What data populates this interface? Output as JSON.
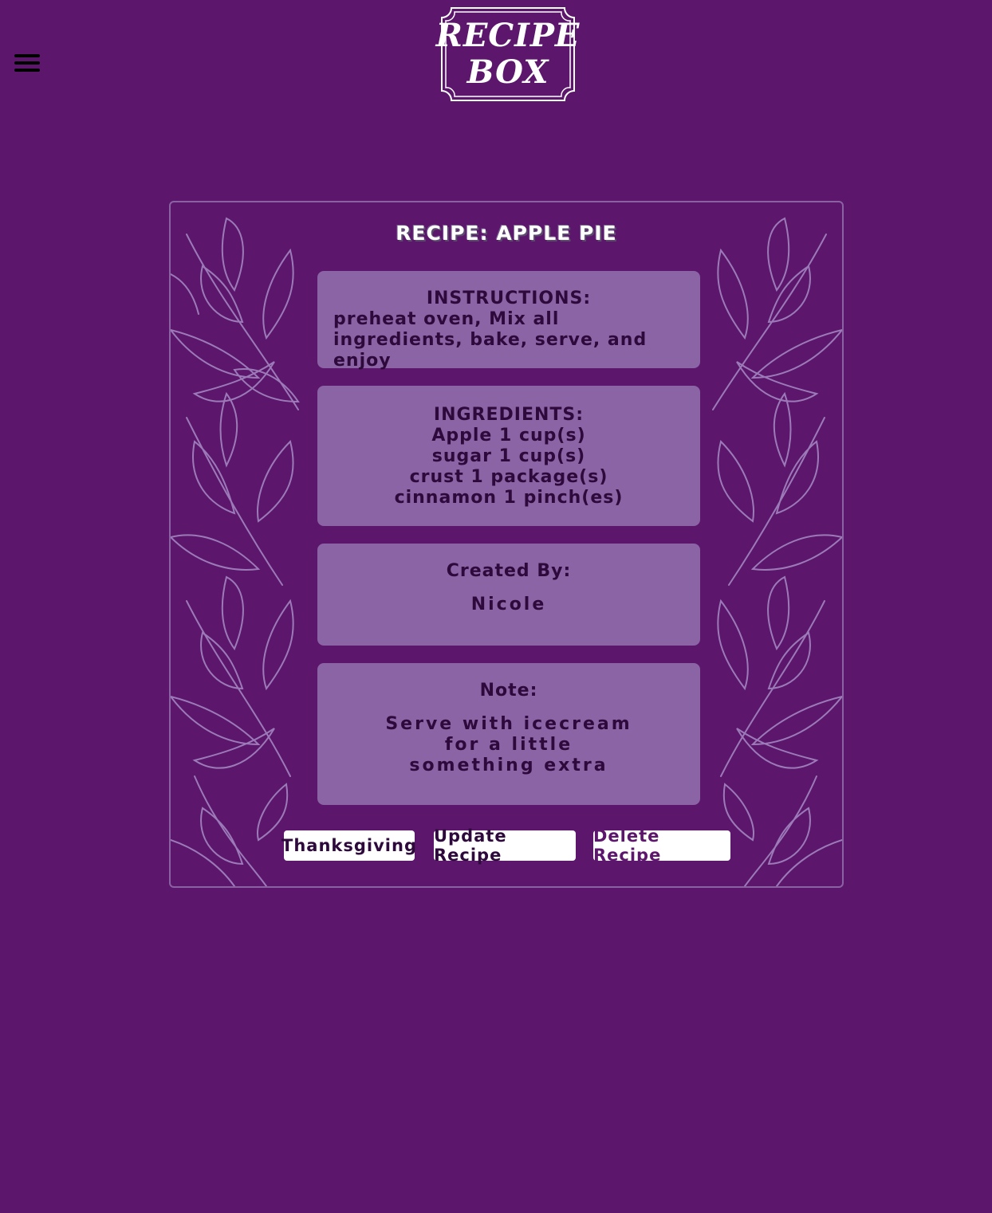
{
  "header": {
    "menu_icon": "hamburger-menu-icon",
    "logo": {
      "line1": "RECIPE",
      "line2": "BOX"
    }
  },
  "recipe": {
    "title": "RECIPE: APPLE PIE",
    "instructions": {
      "label": "INSTRUCTIONS:",
      "body": "preheat oven, Mix all ingredients, bake, serve, and enjoy"
    },
    "ingredients": {
      "label": "INGREDIENTS:",
      "items": [
        "Apple 1 cup(s)",
        "sugar 1 cup(s)",
        "crust 1 package(s)",
        "cinnamon 1 pinch(es)"
      ]
    },
    "created_by": {
      "label": "Created By:",
      "name": "Nicole"
    },
    "note": {
      "label": "Note:",
      "body": "Serve with icecream for a little something extra"
    }
  },
  "actions": {
    "tag": "Thanksgiving",
    "update": "Update Recipe",
    "delete": "Delete Recipe"
  },
  "colors": {
    "background": "#5c176d",
    "panel": "#8a64a4",
    "panel_text": "#2e0a3c",
    "leaf_outline": "#9c7ab8"
  }
}
